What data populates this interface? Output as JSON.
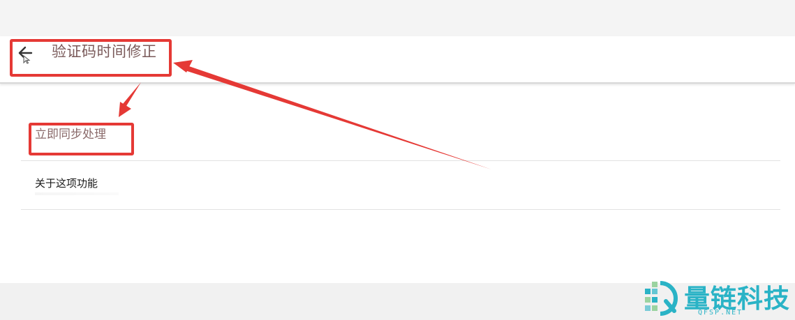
{
  "header": {
    "title": "验证码时间修正",
    "back_icon": "arrow-left-icon"
  },
  "settings": {
    "items": [
      {
        "label": "立即同步处理"
      },
      {
        "label": "关于这项功能"
      }
    ]
  },
  "annotations": {
    "color": "#e53935"
  },
  "watermark": {
    "name": "量链科技",
    "domain": "QFSP.NET",
    "color": "#2ab3c6"
  }
}
